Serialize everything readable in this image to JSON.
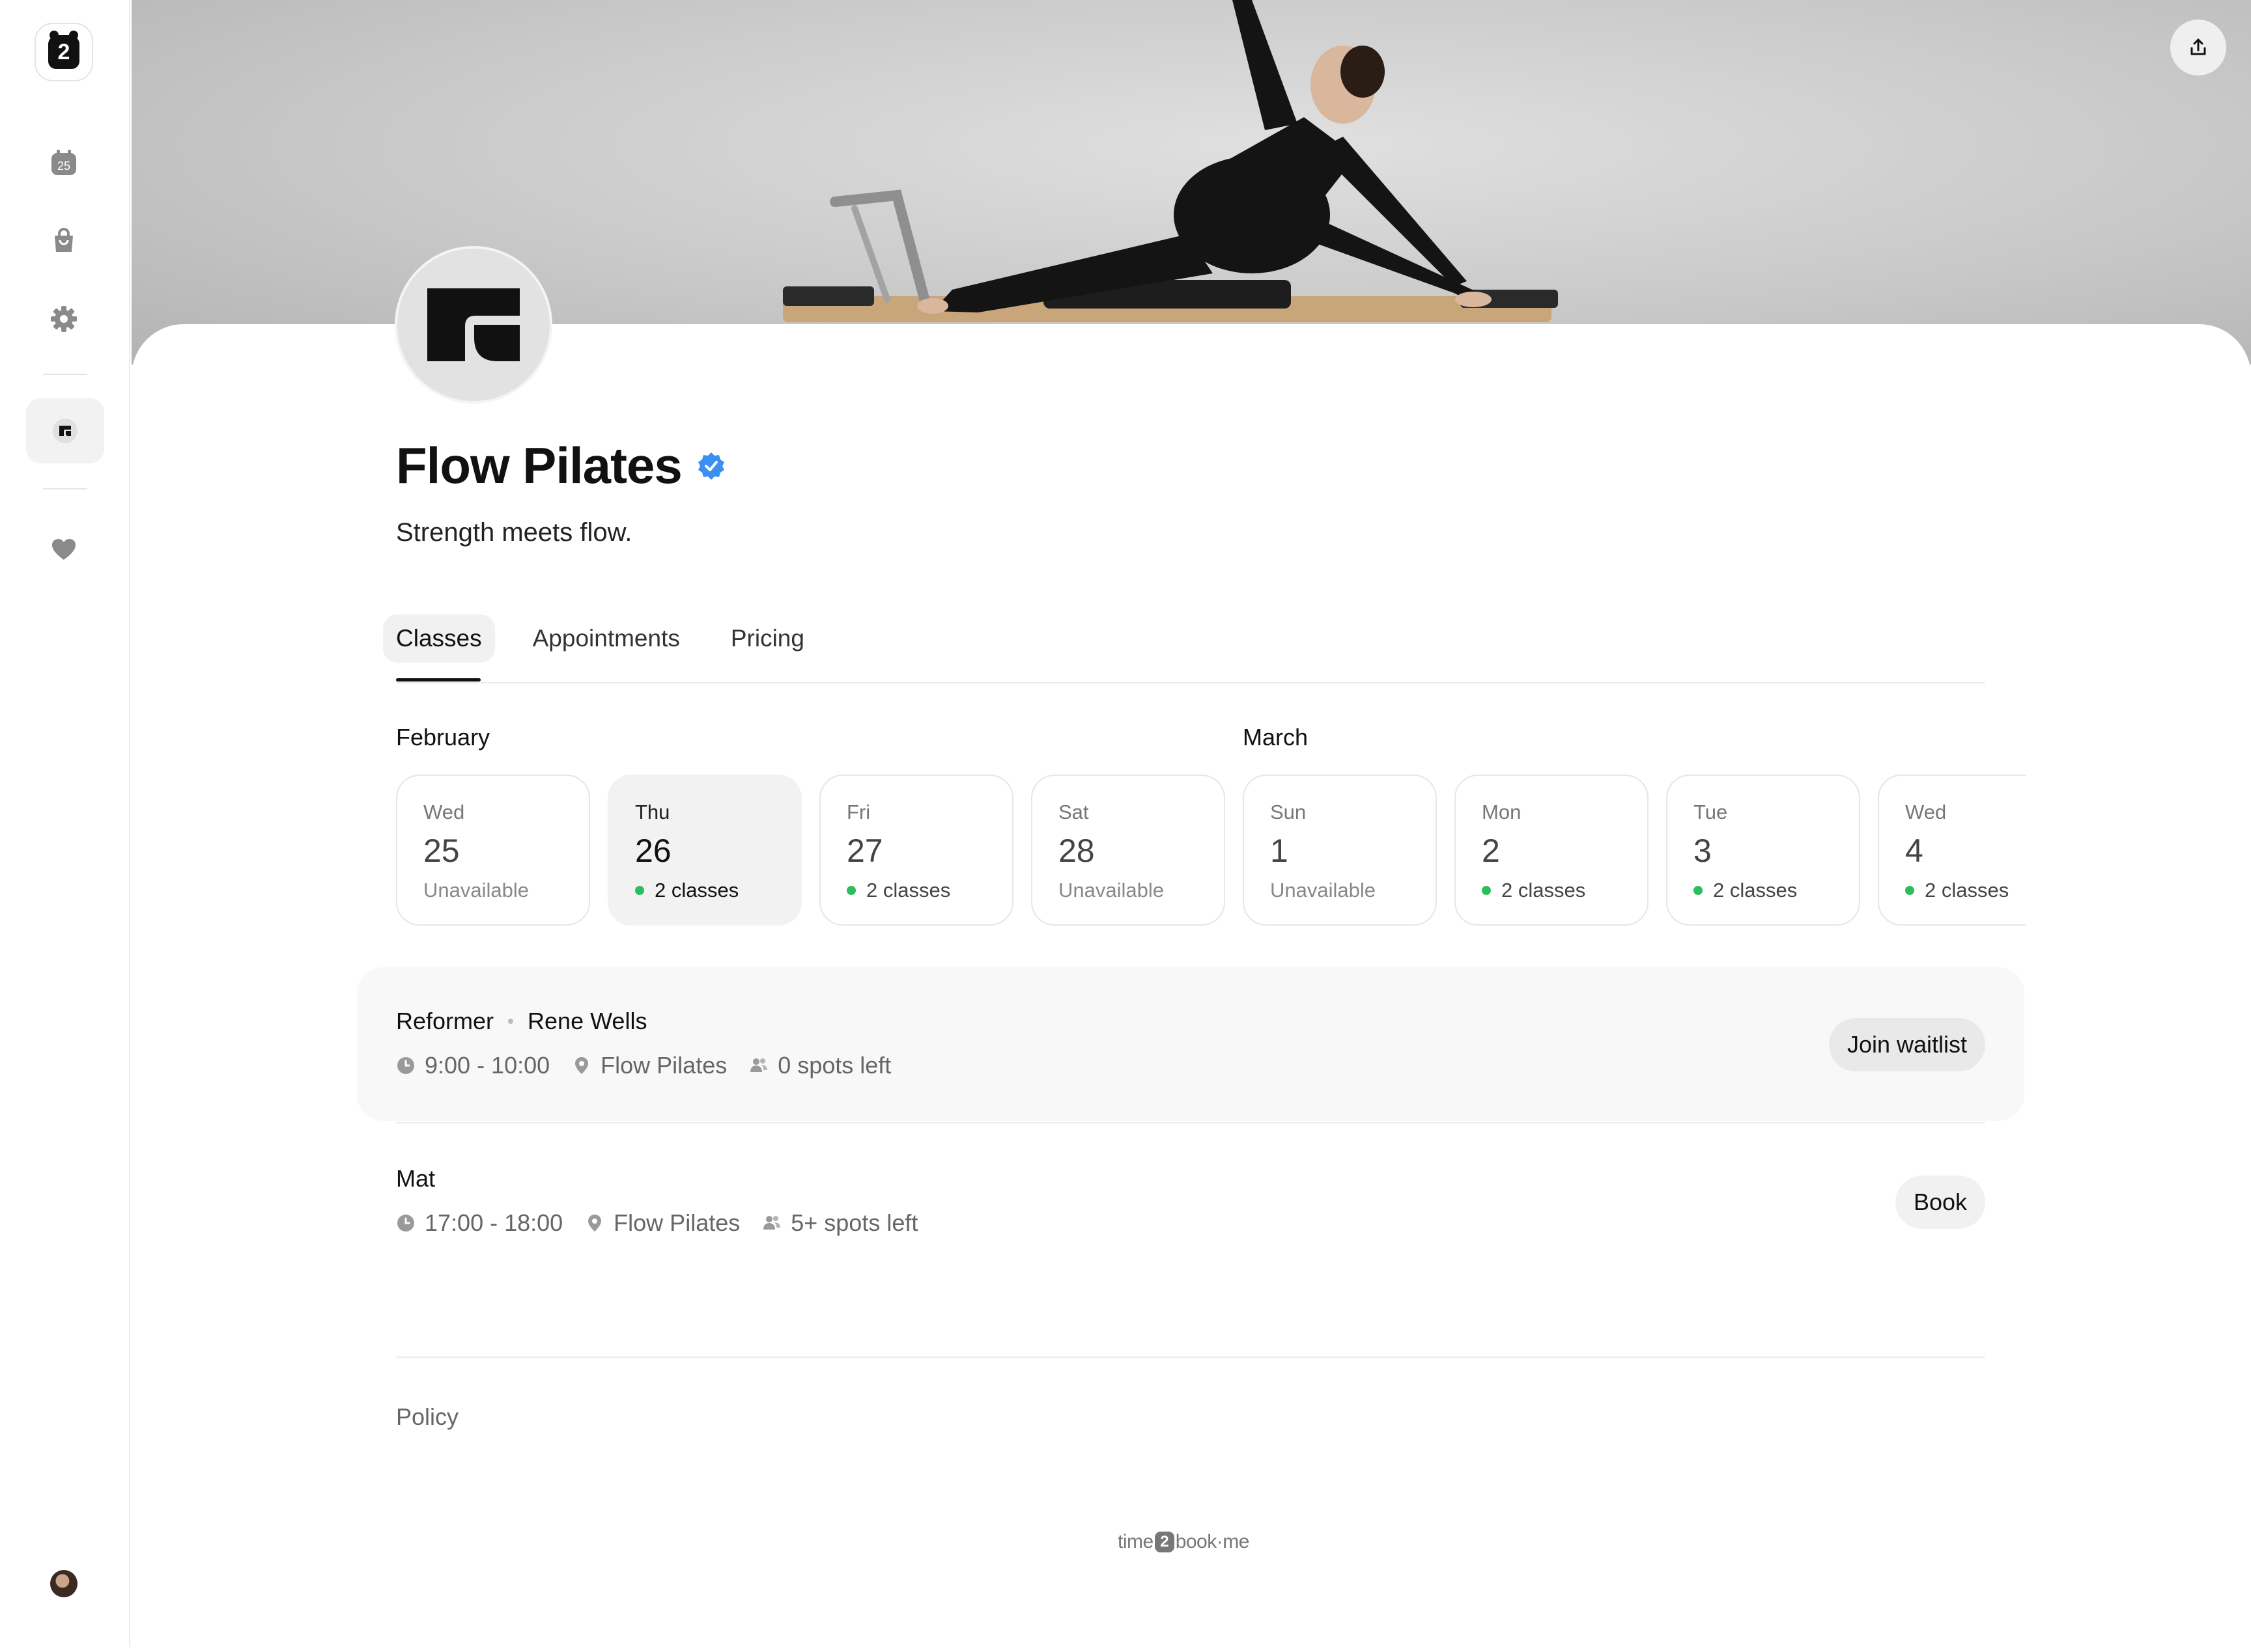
{
  "sidebar": {
    "logo_text": "2",
    "calendar_day": "25",
    "items": [
      {
        "icon": "calendar-icon"
      },
      {
        "icon": "shopping-bag-icon"
      },
      {
        "icon": "gear-icon"
      },
      {
        "icon": "studio-logo-icon"
      },
      {
        "icon": "heart-icon"
      }
    ]
  },
  "banner": {
    "share_icon": "share-icon"
  },
  "studio": {
    "name": "Flow Pilates",
    "tagline": "Strength meets flow.",
    "verified": true
  },
  "tabs": [
    {
      "label": "Classes",
      "active": true
    },
    {
      "label": "Appointments",
      "active": false
    },
    {
      "label": "Pricing",
      "active": false
    }
  ],
  "months": {
    "first": "February",
    "second": "March"
  },
  "days": [
    {
      "dow": "Wed",
      "num": "25",
      "status": "Unavailable",
      "available": false,
      "selected": false
    },
    {
      "dow": "Thu",
      "num": "26",
      "status": "2 classes",
      "available": true,
      "selected": true
    },
    {
      "dow": "Fri",
      "num": "27",
      "status": "2 classes",
      "available": true,
      "selected": false
    },
    {
      "dow": "Sat",
      "num": "28",
      "status": "Unavailable",
      "available": false,
      "selected": false
    },
    {
      "dow": "Sun",
      "num": "1",
      "status": "Unavailable",
      "available": false,
      "selected": false
    },
    {
      "dow": "Mon",
      "num": "2",
      "status": "2 classes",
      "available": true,
      "selected": false
    },
    {
      "dow": "Tue",
      "num": "3",
      "status": "2 classes",
      "available": true,
      "selected": false
    },
    {
      "dow": "Wed",
      "num": "4",
      "status": "2 classes",
      "available": true,
      "selected": false
    }
  ],
  "classes": [
    {
      "name": "Reformer",
      "instructor": "Rene Wells",
      "time": "9:00 - 10:00",
      "location": "Flow Pilates",
      "spots": "0 spots left",
      "action": "Join waitlist"
    },
    {
      "name": "Mat",
      "instructor": "",
      "time": "17:00 - 18:00",
      "location": "Flow Pilates",
      "spots": "5+ spots left",
      "action": "Book"
    }
  ],
  "footer": {
    "policy": "Policy",
    "brand_left": "time",
    "brand_mid": "2",
    "brand_right": "book·me"
  },
  "colors": {
    "accent_green": "#2ebd5c",
    "verified_blue": "#3b8ff0"
  }
}
